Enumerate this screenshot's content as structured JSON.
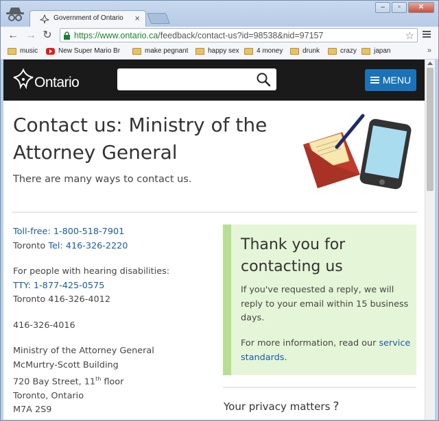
{
  "browser": {
    "tab_title": "Government of Ontario",
    "url_secure": "https://www.ontario.ca",
    "url_path": "/feedback/contact-us?id=98538&nid=97157",
    "window_buttons": [
      "–",
      "▫",
      "✕"
    ],
    "bookmarks": [
      {
        "label": "music",
        "icon": "folder-icon"
      },
      {
        "label": "New Super Mario Bros",
        "icon": "youtube-icon"
      },
      {
        "label": "make pegnant",
        "icon": "folder-icon"
      },
      {
        "label": "happy sex",
        "icon": "folder-icon"
      },
      {
        "label": "4 money",
        "icon": "folder-icon"
      },
      {
        "label": "drunk",
        "icon": "folder-icon"
      },
      {
        "label": "crazy",
        "icon": "folder-icon"
      },
      {
        "label": "japan",
        "icon": "folder-icon"
      }
    ],
    "bookmarks_more": "»"
  },
  "header": {
    "logo_text": "Ontario",
    "search_value": "",
    "menu_label": "MENU",
    "background_color": "#1a1a1a",
    "menu_color": "#1a73b8"
  },
  "main": {
    "title": "Contact us: Ministry of the Attorney General",
    "lede": "There are many ways to contact us.",
    "contact": {
      "tollfree_label": "Toll-free",
      "tollfree_number": "1-800-518-7901",
      "toronto_prefix": "Toronto",
      "tel_label": "Tel",
      "tel_number": "416-326-2220",
      "hearing_label": "For people with hearing disabilities:",
      "tty_label": "TTY",
      "tty_number": "1-877-425-0575",
      "toronto_tty": "Toronto 416-326-4012",
      "fax": "416-326-4016",
      "address_line1": "Ministry of the Attorney General",
      "address_line2": "McMurtry-Scott Building",
      "address_street": "720 Bay Street, 11",
      "address_sup": "th",
      "address_floor": " floor",
      "address_city": "Toronto, Ontario",
      "address_postal": "M7A 2S9"
    },
    "thanks": {
      "title": "Thank you for contacting us",
      "body": "If you've requested a reply, we will reply to your email within 15 business days.",
      "more_prefix": "For more information, read our ",
      "more_link": "service standards",
      "more_suffix": ".",
      "background": "#e5f5d7",
      "accent": "#b7df94"
    },
    "privacy_heading": "Your privacy matters",
    "privacy_icon": "?"
  }
}
